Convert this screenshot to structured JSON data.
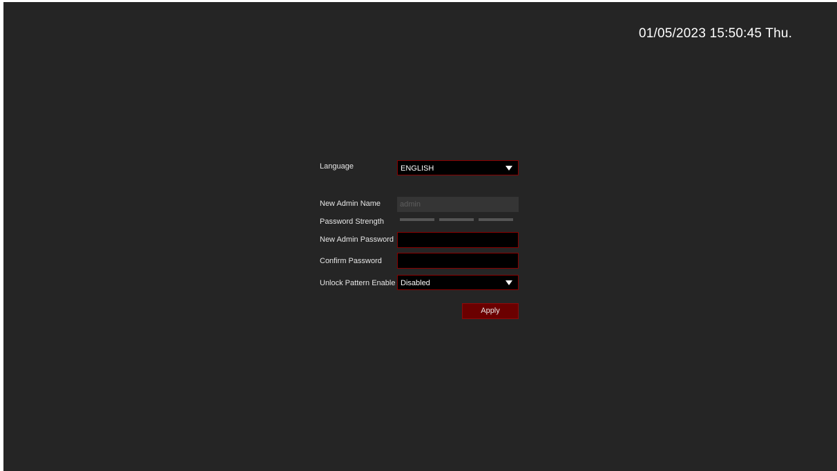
{
  "clock": {
    "datetime": "01/05/2023 15:50:45 Thu."
  },
  "form": {
    "language": {
      "label": "Language",
      "selected": "ENGLISH"
    },
    "admin_name": {
      "label": "New Admin Name",
      "value": "admin"
    },
    "password_strength": {
      "label": "Password Strength",
      "segments": 3,
      "filled": 0
    },
    "admin_password": {
      "label": "New Admin Password",
      "value": ""
    },
    "confirm_password": {
      "label": "Confirm Password",
      "value": ""
    },
    "unlock_pattern": {
      "label": "Unlock Pattern Enable",
      "selected": "Disabled"
    },
    "apply_label": "Apply"
  },
  "colors": {
    "background": "#252525",
    "accent_border": "#8a0000",
    "button": "#6b0000"
  },
  "icons": {
    "dropdown": "caret-down-icon"
  }
}
